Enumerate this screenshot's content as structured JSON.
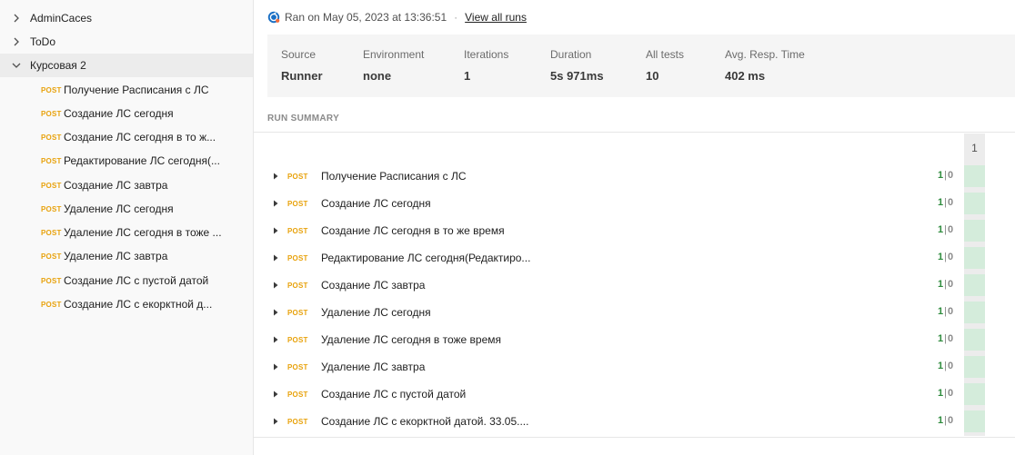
{
  "sidebar": {
    "collections": [
      {
        "label": "AdminCaces",
        "expanded": false
      },
      {
        "label": "ToDo",
        "expanded": false
      },
      {
        "label": "Курсовая 2",
        "expanded": true
      }
    ],
    "requests": [
      {
        "method": "POST",
        "name": "Получение Расписания с ЛС"
      },
      {
        "method": "POST",
        "name": "Создание ЛС сегодня"
      },
      {
        "method": "POST",
        "name": "Создание ЛС сегодня в то ж..."
      },
      {
        "method": "POST",
        "name": "Редактирование ЛС сегодня(..."
      },
      {
        "method": "POST",
        "name": "Создание ЛС завтра"
      },
      {
        "method": "POST",
        "name": "Удаление ЛС сегодня"
      },
      {
        "method": "POST",
        "name": "Удаление ЛС сегодня в тоже ..."
      },
      {
        "method": "POST",
        "name": "Удаление ЛС завтра"
      },
      {
        "method": "POST",
        "name": "Создание ЛС с пустой датой"
      },
      {
        "method": "POST",
        "name": "Создание ЛС с екоркт­ной д..."
      }
    ]
  },
  "run": {
    "ran_on": "Ran on May 05, 2023 at 13:36:51",
    "separator": "·",
    "view_all": "View all runs",
    "icon": "runner-icon"
  },
  "stats": [
    {
      "label": "Source",
      "value": "Runner"
    },
    {
      "label": "Environment",
      "value": "none"
    },
    {
      "label": "Iterations",
      "value": "1"
    },
    {
      "label": "Duration",
      "value": "5s 971ms"
    },
    {
      "label": "All tests",
      "value": "10"
    },
    {
      "label": "Avg. Resp. Time",
      "value": "402 ms"
    }
  ],
  "summary": {
    "title": "RUN SUMMARY",
    "iteration_header": "1",
    "pipe": "|",
    "rows": [
      {
        "method": "POST",
        "name": "Получение Расписания с ЛС",
        "passed": "1",
        "failed": "0"
      },
      {
        "method": "POST",
        "name": "Создание ЛС сегодня",
        "passed": "1",
        "failed": "0"
      },
      {
        "method": "POST",
        "name": "Создание ЛС сегодня в то же время",
        "passed": "1",
        "failed": "0"
      },
      {
        "method": "POST",
        "name": "Редактирование ЛС сегодня(Редактиро...",
        "passed": "1",
        "failed": "0"
      },
      {
        "method": "POST",
        "name": "Создание ЛС завтра",
        "passed": "1",
        "failed": "0"
      },
      {
        "method": "POST",
        "name": "Удаление ЛС сегодня",
        "passed": "1",
        "failed": "0"
      },
      {
        "method": "POST",
        "name": "Удаление ЛС сегодня в тоже время",
        "passed": "1",
        "failed": "0"
      },
      {
        "method": "POST",
        "name": "Удаление ЛС завтра",
        "passed": "1",
        "failed": "0"
      },
      {
        "method": "POST",
        "name": "Создание ЛС с пустой датой",
        "passed": "1",
        "failed": "0"
      },
      {
        "method": "POST",
        "name": "Создание ЛС с екоркт­ной датой. 33.05....",
        "passed": "1",
        "failed": "0"
      }
    ]
  },
  "colors": {
    "method_post": "#e8a20c",
    "pass": "#2e8b3d",
    "cell_pass": "#d4ecdb"
  }
}
